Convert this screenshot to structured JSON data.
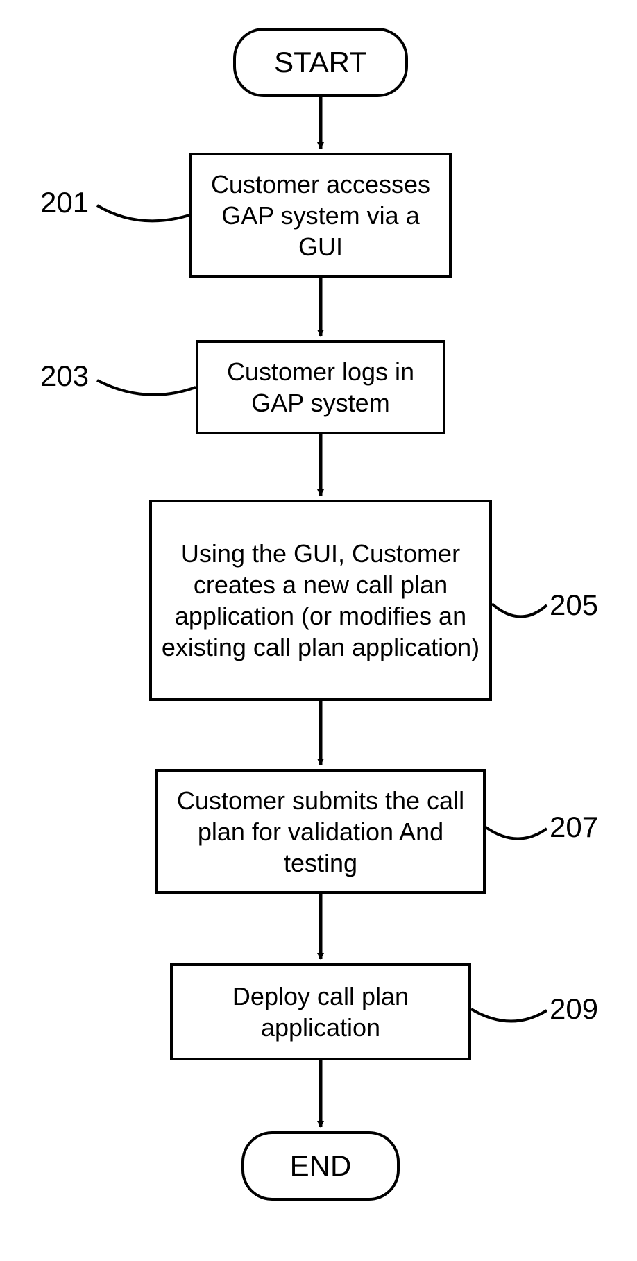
{
  "flow": {
    "start": "START",
    "end": "END",
    "steps": {
      "s201": {
        "ref": "201",
        "text": "Customer accesses GAP system via a GUI"
      },
      "s203": {
        "ref": "203",
        "text": "Customer logs in GAP system"
      },
      "s205": {
        "ref": "205",
        "text": "Using the GUI, Customer creates a new call plan application (or modifies an existing call plan application)"
      },
      "s207": {
        "ref": "207",
        "text": "Customer submits the call plan for validation And testing"
      },
      "s209": {
        "ref": "209",
        "text": "Deploy call plan application"
      }
    }
  }
}
